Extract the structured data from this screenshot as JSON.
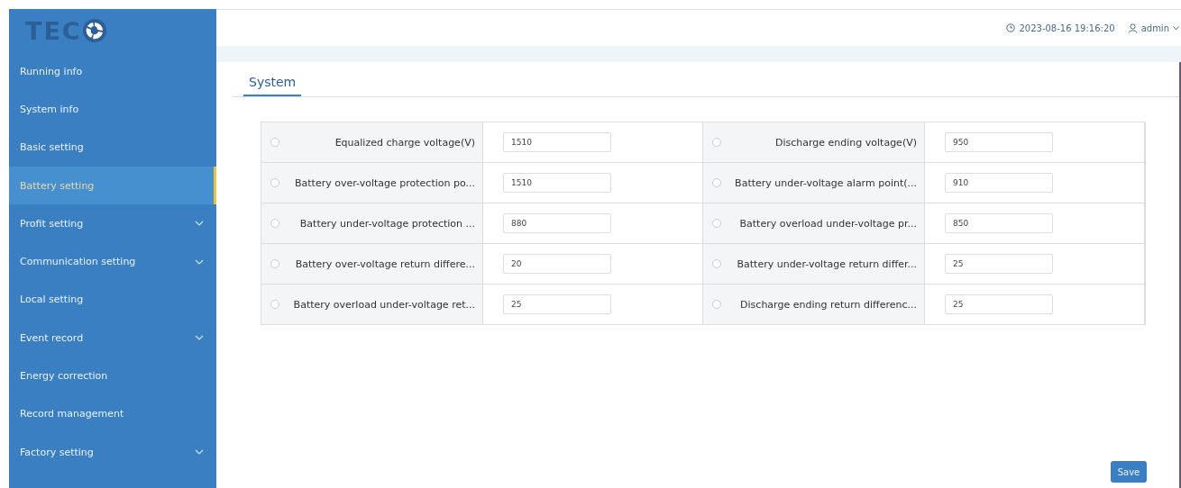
{
  "logo": {
    "text": "TEC"
  },
  "sidebar": {
    "items": [
      {
        "label": "Running info",
        "selected": false,
        "expandable": false
      },
      {
        "label": "System info",
        "selected": false,
        "expandable": false
      },
      {
        "label": "Basic setting",
        "selected": false,
        "expandable": false
      },
      {
        "label": "Battery setting",
        "selected": true,
        "expandable": false
      },
      {
        "label": "Profit setting",
        "selected": false,
        "expandable": true
      },
      {
        "label": "Communication setting",
        "selected": false,
        "expandable": true
      },
      {
        "label": "Local setting",
        "selected": false,
        "expandable": false
      },
      {
        "label": "Event record",
        "selected": false,
        "expandable": true
      },
      {
        "label": "Energy correction",
        "selected": false,
        "expandable": false
      },
      {
        "label": "Record management",
        "selected": false,
        "expandable": false
      },
      {
        "label": "Factory setting",
        "selected": false,
        "expandable": true
      }
    ]
  },
  "header": {
    "datetime": "2023-08-16 19:16:20",
    "user": "admin"
  },
  "tabs": [
    {
      "label": "System",
      "selected": true
    }
  ],
  "settings": [
    {
      "label": "Equalized charge voltage(V)",
      "value": "1510",
      "selected": false
    },
    {
      "label": "Discharge ending voltage(V)",
      "value": "950",
      "selected": false
    },
    {
      "label": "Battery over-voltage protection po...",
      "value": "1510",
      "selected": false
    },
    {
      "label": "Battery under-voltage alarm point(...",
      "value": "910",
      "selected": false
    },
    {
      "label": "Battery under-voltage protection ...",
      "value": "880",
      "selected": false
    },
    {
      "label": "Battery overload under-voltage pr...",
      "value": "850",
      "selected": false
    },
    {
      "label": "Battery over-voltage return differe...",
      "value": "20",
      "selected": false
    },
    {
      "label": "Battery under-voltage return differ...",
      "value": "25",
      "selected": false
    },
    {
      "label": "Battery overload under-voltage ret...",
      "value": "25",
      "selected": false
    },
    {
      "label": "Discharge ending return differenc...",
      "value": "25",
      "selected": false
    }
  ],
  "buttons": [
    {
      "label": "Save"
    }
  ]
}
